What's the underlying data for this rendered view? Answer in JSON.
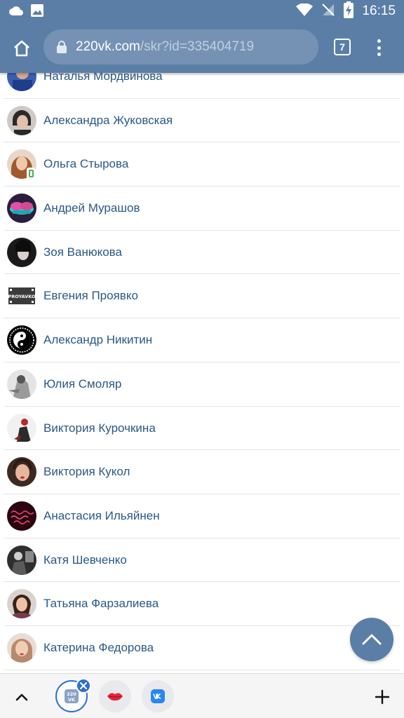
{
  "status_bar": {
    "time": "16:15",
    "icons": [
      "cloud-icon",
      "image-icon",
      "wifi-icon",
      "no-signal-icon",
      "battery-charging-icon"
    ]
  },
  "browser": {
    "url_host": "220vk.com",
    "url_path": "/skr?id=335404719",
    "tab_count": "7",
    "icons": [
      "home-icon",
      "lock-icon",
      "more-vertical-icon"
    ]
  },
  "contacts": [
    {
      "name": "Наталья Мордвинова"
    },
    {
      "name": "Александра Жуковская"
    },
    {
      "name": "Ольга Стырова"
    },
    {
      "name": "Андрей Мурашов"
    },
    {
      "name": "Зоя Ванюкова"
    },
    {
      "name": "Евгения Проявко"
    },
    {
      "name": "Александр Никитин"
    },
    {
      "name": "Юлия Смоляр"
    },
    {
      "name": "Виктория Курочкина"
    },
    {
      "name": "Виктория Кукол"
    },
    {
      "name": "Анастасия Ильяйнен"
    },
    {
      "name": "Катя Шевченко"
    },
    {
      "name": "Татьяна Фарзалиева"
    },
    {
      "name": "Катерина Федорова"
    }
  ],
  "avatar_badges": {
    "proyavko_text": "PROYAVKO",
    "tab_220vk_text_top": "220",
    "tab_220vk_text_bottom": "VK"
  },
  "colors": {
    "header": "#5b7ea7",
    "name_link": "#2a5885",
    "online_mobile": "#4bb34b",
    "active_tab": "#2f6fd1"
  },
  "bottom_bar": {
    "icons": [
      "chevron-up-icon",
      "tab-220vk-icon",
      "close-icon",
      "tab-lips-icon",
      "tab-vk-icon",
      "plus-icon"
    ]
  }
}
